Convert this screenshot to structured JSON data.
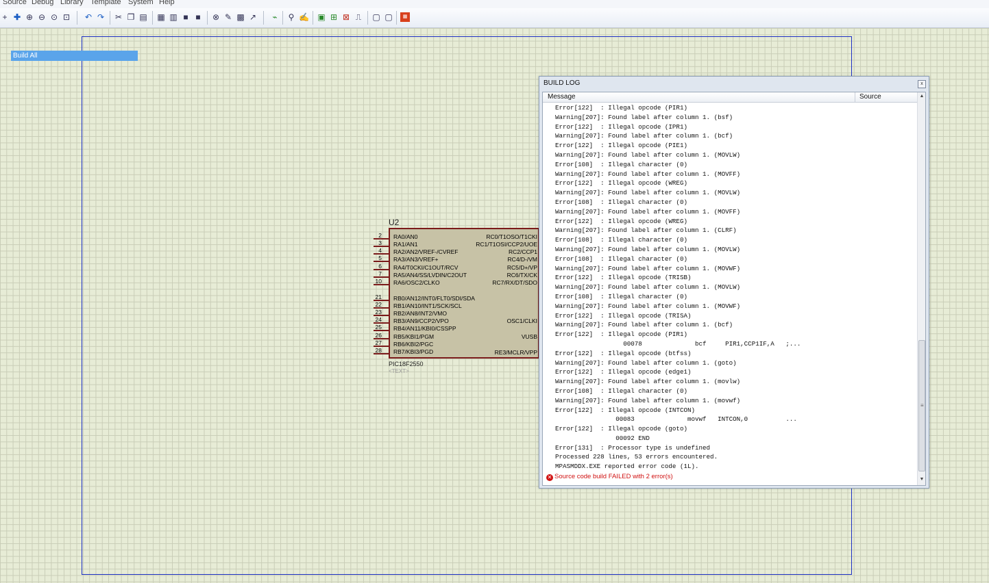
{
  "menu": [
    "Source",
    "Debug",
    "Library",
    "Template",
    "System",
    "Help"
  ],
  "toolbar_icons": [
    "add-icon",
    "zoom-in-icon",
    "zoom-out-icon",
    "zoom-all-icon",
    "zoom-area-icon",
    "undo-icon",
    "redo-icon",
    "cut-icon",
    "copy-icon",
    "paste-icon",
    "block-copy-icon",
    "block-move-icon",
    "block-rotate-icon",
    "block-delete-icon",
    "pick-device-icon",
    "make-device-icon",
    "package-icon",
    "decompose-icon",
    "wire-autorouter-icon",
    "search-icon",
    "property-assign-icon",
    "netlist-icon",
    "bill-of-materials-icon",
    "erc-icon",
    "ares-icon",
    "new-sheet-icon",
    "remove-sheet-icon",
    "ares-export-icon"
  ],
  "context_menu": {
    "build_all": "Build All"
  },
  "component": {
    "ref": "U2",
    "part": "PIC18F2550",
    "text_placeholder": "<TEXT>",
    "left_pins": [
      {
        "num": "2",
        "label": "RA0/AN0"
      },
      {
        "num": "3",
        "label": "RA1/AN1"
      },
      {
        "num": "4",
        "label": "RA2/AN2/VREF-/CVREF"
      },
      {
        "num": "5",
        "label": "RA3/AN3/VREF+"
      },
      {
        "num": "6",
        "label": "RA4/T0CKI/C1OUT/RCV"
      },
      {
        "num": "7",
        "label": "RA5/AN4/SS/LVDIN/C2OUT"
      },
      {
        "num": "10",
        "label": "RA6/OSC2/CLKO"
      },
      {
        "num": "21",
        "label": "RB0/AN12/INT0/FLT0/SDI/SDA"
      },
      {
        "num": "22",
        "label": "RB1/AN10/INT1/SCK/SCL"
      },
      {
        "num": "23",
        "label": "RB2/AN8/INT2/VMO"
      },
      {
        "num": "24",
        "label": "RB3/AN9/CCP2/VPO"
      },
      {
        "num": "25",
        "label": "RB4/AN11/KBI0/CSSPP"
      },
      {
        "num": "26",
        "label": "RB5/KBI1/PGM"
      },
      {
        "num": "27",
        "label": "RB6/KBI2/PGC"
      },
      {
        "num": "28",
        "label": "RB7/KBI3/PGD"
      }
    ],
    "right_pins": [
      "RC0/T1OSO/T1CKI",
      "RC1/T1OSI/CCP2/UOE",
      "RC2/CCP1",
      "RC4/D-/VM",
      "RC5/D+/VP",
      "RC6/TX/CK",
      "RC7/RX/DT/SDO",
      "OSC1/CLKI",
      "VUSB",
      "RE3/MCLR/VPP"
    ]
  },
  "build_log": {
    "title": "BUILD LOG",
    "close_label": "x",
    "columns": {
      "message": "Message",
      "source": "Source"
    },
    "lines": [
      "Error[122]  : Illegal opcode (PIR1)",
      "Warning[207]: Found label after column 1. (bsf)",
      "Error[122]  : Illegal opcode (IPR1)",
      "Warning[207]: Found label after column 1. (bcf)",
      "Error[122]  : Illegal opcode (PIE1)",
      "Warning[207]: Found label after column 1. (MOVLW)",
      "Error[108]  : Illegal character (0)",
      "Warning[207]: Found label after column 1. (MOVFF)",
      "Error[122]  : Illegal opcode (WREG)",
      "Warning[207]: Found label after column 1. (MOVLW)",
      "Error[108]  : Illegal character (0)",
      "Warning[207]: Found label after column 1. (MOVFF)",
      "Error[122]  : Illegal opcode (WREG)",
      "Warning[207]: Found label after column 1. (CLRF)",
      "Error[108]  : Illegal character (0)",
      "Warning[207]: Found label after column 1. (MOVLW)",
      "Error[108]  : Illegal character (0)",
      "Warning[207]: Found label after column 1. (MOVWF)",
      "Error[122]  : Illegal opcode (TRISB)",
      "Warning[207]: Found label after column 1. (MOVLW)",
      "Error[108]  : Illegal character (0)",
      "Warning[207]: Found label after column 1. (MOVWF)",
      "Error[122]  : Illegal opcode (TRISA)",
      "Warning[207]: Found label after column 1. (bcf)",
      "Error[122]  : Illegal opcode (PIR1)",
      "                  00078              bcf     PIR1,CCP1IF,A   ;...",
      "Error[122]  : Illegal opcode (btfss)",
      "Warning[207]: Found label after column 1. (goto)",
      "Error[122]  : Illegal opcode (edge1)",
      "Warning[207]: Found label after column 1. (movlw)",
      "Error[108]  : Illegal character (0)",
      "Warning[207]: Found label after column 1. (movwf)",
      "Error[122]  : Illegal opcode (INTCON)",
      "                00083              movwf   INTCON,0          ...",
      "Error[122]  : Illegal opcode (goto)",
      "                00092 END",
      "Error[131]  : Processor type is undefined",
      "Processed 228 lines, 53 errors encountered.",
      "MPASMDDX.EXE reported error code (1L)."
    ],
    "status": "Source code build FAILED with 2 error(s)"
  }
}
